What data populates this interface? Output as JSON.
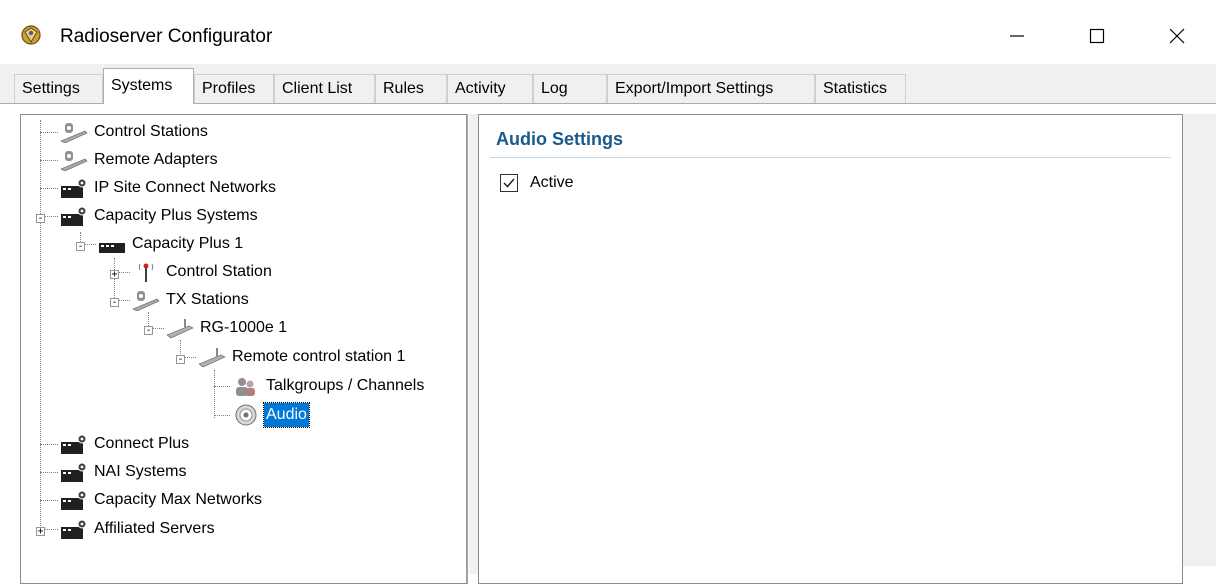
{
  "window": {
    "title": "Radioserver Configurator",
    "minimize_glyph": "—",
    "maximize_glyph": "☐",
    "close_glyph": "✕"
  },
  "tabs": [
    {
      "label": "Settings",
      "active": false
    },
    {
      "label": "Systems",
      "active": true
    },
    {
      "label": "Profiles",
      "active": false
    },
    {
      "label": "Client List",
      "active": false
    },
    {
      "label": "Rules",
      "active": false
    },
    {
      "label": "Activity",
      "active": false
    },
    {
      "label": "Log",
      "active": false
    },
    {
      "label": "Export/Import Settings",
      "active": false
    },
    {
      "label": "Statistics",
      "active": false
    }
  ],
  "tree": {
    "items": [
      {
        "label": "Control Stations",
        "icon": "control-stations-icon"
      },
      {
        "label": "Remote Adapters",
        "icon": "remote-adapters-icon"
      },
      {
        "label": "IP Site Connect Networks",
        "icon": "network-icon"
      },
      {
        "label": "Capacity Plus Systems",
        "icon": "network-icon",
        "expanded": true
      },
      {
        "label": "Capacity Plus 1",
        "icon": "system-icon",
        "expanded": true
      },
      {
        "label": "Control Station",
        "icon": "antenna-icon",
        "expanded": false
      },
      {
        "label": "TX Stations",
        "icon": "control-stations-icon",
        "expanded": true
      },
      {
        "label": "RG-1000e 1",
        "icon": "gateway-icon",
        "expanded": true
      },
      {
        "label": "Remote control station 1",
        "icon": "gateway-icon",
        "expanded": true
      },
      {
        "label": "Talkgroups / Channels",
        "icon": "talkgroups-icon"
      },
      {
        "label": "Audio",
        "icon": "speaker-icon",
        "selected": true
      },
      {
        "label": "Connect Plus",
        "icon": "network-icon"
      },
      {
        "label": "NAI Systems",
        "icon": "network-icon"
      },
      {
        "label": "Capacity Max Networks",
        "icon": "network-icon"
      },
      {
        "label": "Affiliated Servers",
        "icon": "network-icon",
        "expanded": false
      }
    ]
  },
  "detail": {
    "section_title": "Audio Settings",
    "active_label": "Active",
    "active_checked": true
  }
}
